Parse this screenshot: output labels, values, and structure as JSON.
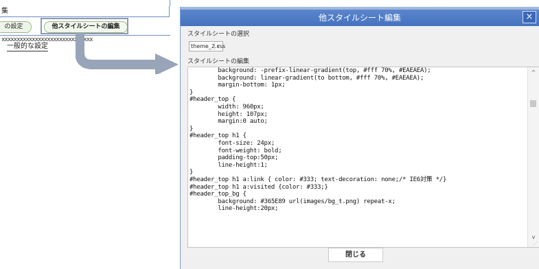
{
  "background": {
    "title_fragment": "集",
    "settings_button_label": "の設定",
    "edit_other_style_button_label": "他スタイルシートの編集",
    "stars_text": "xxxxxxxxxxxxxxxxxxxxxxxxxxxxxx",
    "general_settings_label": "一般的な設定"
  },
  "dialog": {
    "title": "他スタイルシート編集",
    "close_icon": "×",
    "select_label": "スタイルシートの選択",
    "selected_file": "theme_2.css",
    "select_chevron": "∨",
    "edit_label": "スタイルシートの編集",
    "scroll_up_glyph": "^",
    "scroll_down_glyph": "v",
    "resize_glyph": "⋰",
    "code_lines": [
      "        background: -prefix-linear-gradient(top, #fff 70%, #EAEAEA);",
      "        background: linear-gradient(to bottom, #fff 70%, #EAEAEA);",
      "        margin-bottom: 1px;",
      "}",
      "#header_top {",
      "        width: 960px;",
      "        height: 107px;",
      "        margin:0 auto;",
      "}",
      "#header_top h1 {",
      "        font-size: 24px;",
      "        font-weight: bold;",
      "        padding-top:50px;",
      "        line-height:1;",
      "}",
      "#header_top h1 a:link { color: #333; text-decoration: none;/* IE6対策 */}",
      "#header_top h1 a:visited {color: #333;}",
      "#header_top_bg {",
      "        background: #365E89 url(images/bg_t.png) repeat-x;",
      "        line-height:20px;"
    ],
    "close_button_label": "閉じる"
  },
  "colors": {
    "titlebar": "#4a78c5",
    "arrow": "#98a4b8",
    "button_border": "#9bb48a"
  }
}
